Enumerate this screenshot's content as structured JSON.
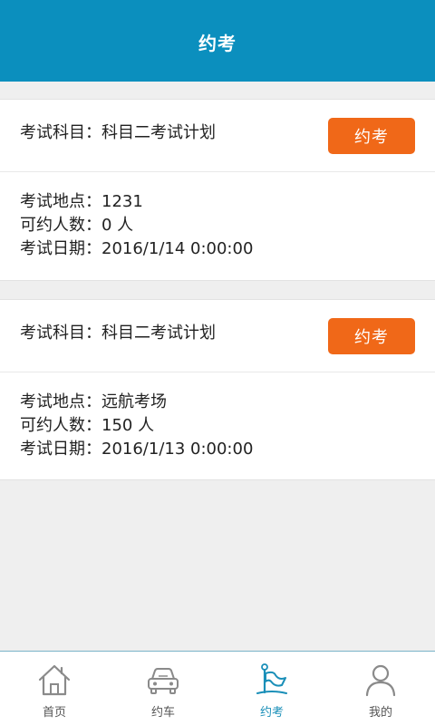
{
  "header": {
    "title": "约考"
  },
  "plans": [
    {
      "subject_label": "考试科目：",
      "subject_value": "科目二考试计划",
      "button_label": "约考",
      "location_label": "考试地点：",
      "location_value": "1231",
      "capacity_label": "可约人数：",
      "capacity_value": "0 人",
      "date_label": "考试日期：",
      "date_value": "2016/1/14 0:00:00"
    },
    {
      "subject_label": "考试科目：",
      "subject_value": "科目二考试计划",
      "button_label": "约考",
      "location_label": "考试地点：",
      "location_value": "远航考场",
      "capacity_label": "可约人数：",
      "capacity_value": "150 人",
      "date_label": "考试日期：",
      "date_value": "2016/1/13 0:00:00"
    }
  ],
  "tabbar": {
    "items": [
      {
        "label": "首页",
        "icon": "home-icon"
      },
      {
        "label": "约车",
        "icon": "car-icon"
      },
      {
        "label": "约考",
        "icon": "flag-icon",
        "active": true
      },
      {
        "label": "我的",
        "icon": "user-icon"
      }
    ]
  },
  "colors": {
    "header_bg": "#0b8fbe",
    "button_bg": "#f06818",
    "active_tab": "#1a8fb8",
    "inactive_tab": "#8a8a8a"
  }
}
